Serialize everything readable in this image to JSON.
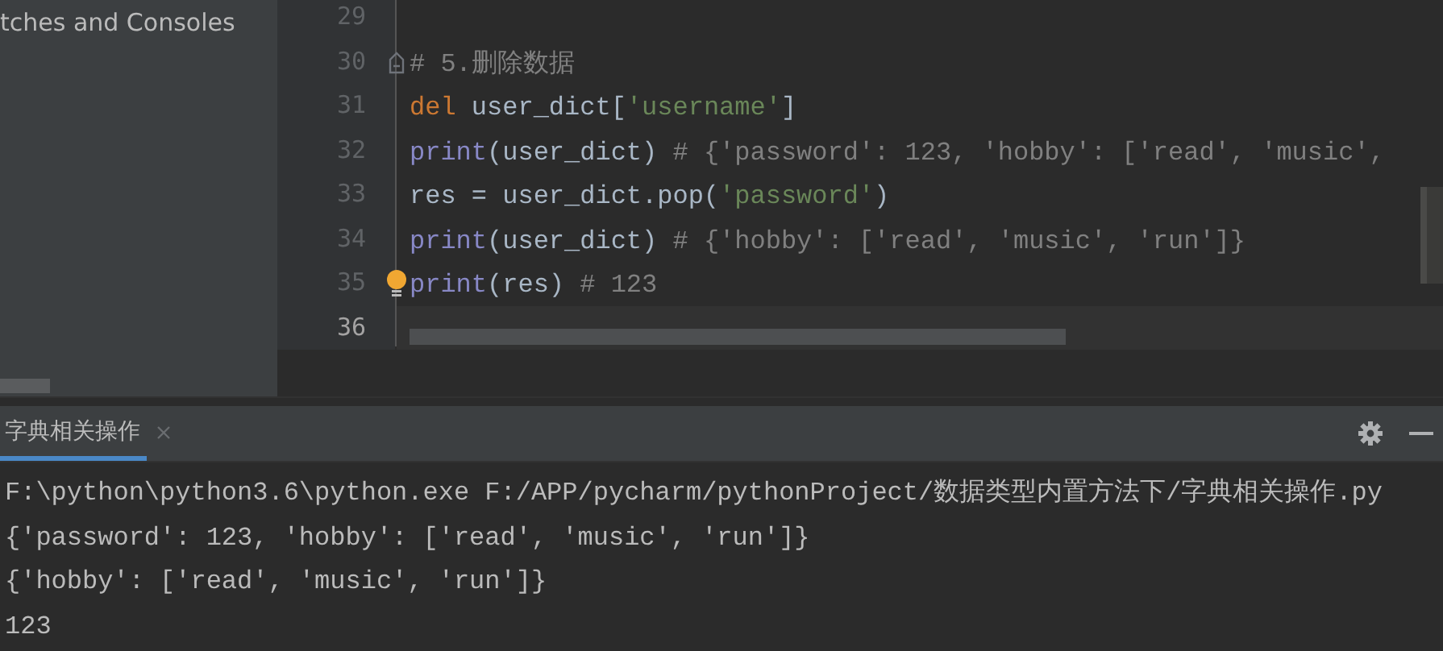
{
  "sidebar": {
    "items": [
      {
        "label": "tches and Consoles"
      }
    ]
  },
  "editor": {
    "lines": [
      {
        "number": "29",
        "current": false
      },
      {
        "number": "30",
        "current": false,
        "tokens": [
          {
            "kind": "comment",
            "text": "# 5.删除数据"
          }
        ]
      },
      {
        "number": "31",
        "current": false,
        "tokens": [
          {
            "kind": "keyword",
            "text": "del"
          },
          {
            "kind": "plain",
            "text": " user_dict["
          },
          {
            "kind": "string",
            "text": "'username'"
          },
          {
            "kind": "plain",
            "text": "]"
          }
        ]
      },
      {
        "number": "32",
        "current": false,
        "tokens": [
          {
            "kind": "builtin",
            "text": "print"
          },
          {
            "kind": "plain",
            "text": "(user_dict) "
          },
          {
            "kind": "comment",
            "text": "# {'password': 123, 'hobby': ['read', 'music',"
          }
        ]
      },
      {
        "number": "33",
        "current": false,
        "tokens": [
          {
            "kind": "plain",
            "text": "res = user_dict.pop("
          },
          {
            "kind": "string",
            "text": "'password'"
          },
          {
            "kind": "plain",
            "text": ")"
          }
        ]
      },
      {
        "number": "34",
        "current": false,
        "tokens": [
          {
            "kind": "builtin",
            "text": "print"
          },
          {
            "kind": "plain",
            "text": "(user_dict) "
          },
          {
            "kind": "comment",
            "text": "# {'hobby': ['read', 'music', 'run']}"
          }
        ]
      },
      {
        "number": "35",
        "current": false,
        "tokens": [
          {
            "kind": "builtin",
            "text": "print"
          },
          {
            "kind": "plain",
            "text": "(res) "
          },
          {
            "kind": "comment",
            "text": "# 123"
          }
        ]
      },
      {
        "number": "36",
        "current": true
      }
    ]
  },
  "run_panel": {
    "tabs": [
      {
        "label": "字典相关操作",
        "selected": true
      }
    ],
    "output": [
      "F:\\python\\python3.6\\python.exe F:/APP/pycharm/pythonProject/数据类型内置方法下/字典相关操作.py",
      "{'password': 123, 'hobby': ['read', 'music', 'run']}",
      "{'hobby': ['read', 'music', 'run']}",
      "123"
    ]
  }
}
